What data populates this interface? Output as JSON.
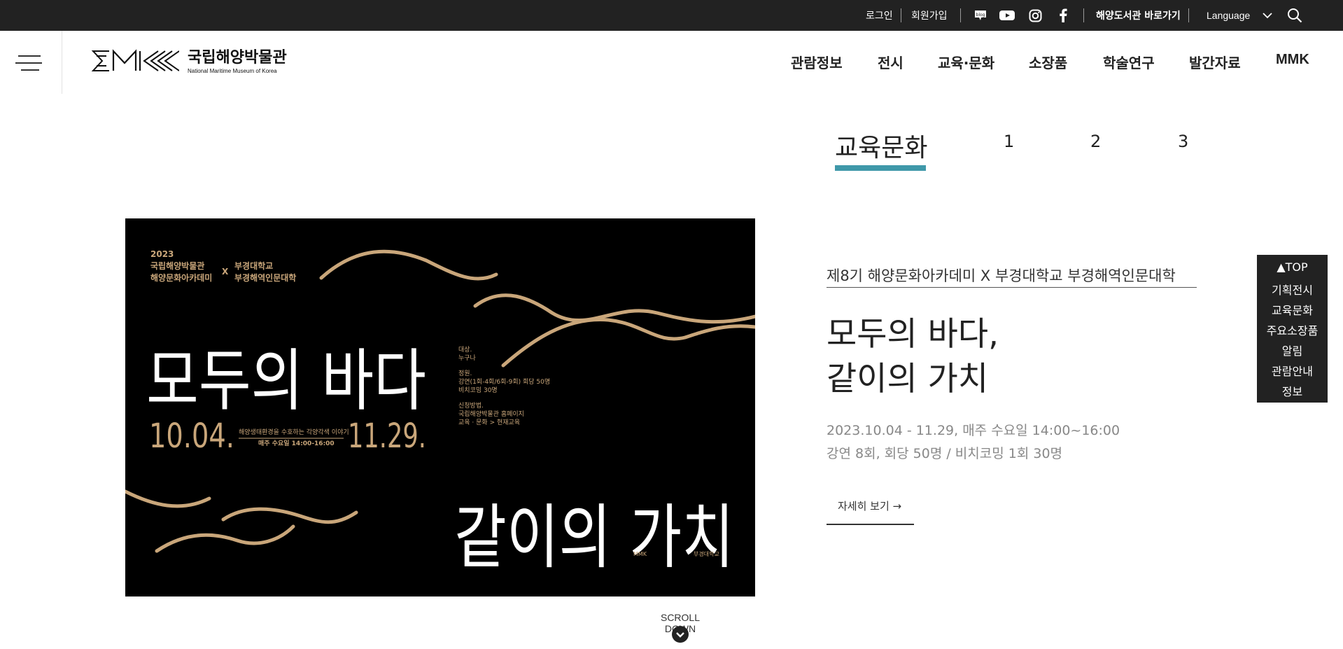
{
  "topbar": {
    "login": "로그인",
    "signup": "회원가입",
    "library_link": "해양도서관 바로가기",
    "language": "Language"
  },
  "header": {
    "logo_ko": "국립해양박물관",
    "logo_en": "National Maritime Museum of Korea",
    "nav": [
      "관람정보",
      "전시",
      "교육·문화",
      "소장품",
      "학술연구",
      "발간자료",
      "MMK"
    ]
  },
  "section_tabs": {
    "active": "교육문화",
    "pages": [
      "1",
      "2",
      "3"
    ]
  },
  "poster": {
    "year_org": "2023",
    "org_line1": "국립해양박물관",
    "org_line2": "해양문화아카데미",
    "x_mark": "X",
    "partner_line1": "부경대학교",
    "partner_line2": "부경해역인문대학",
    "headline_top": "모두의 바다",
    "headline_bottom": "같이의 가치",
    "date_start": "10.04.",
    "date_end": "11.29.",
    "tagline": "해양생태환경을 수호하는 각양각색 이야기",
    "schedule": "매주 수요일 14:00-16:00",
    "target_label": "대상.",
    "target_value": "누구나",
    "capacity_label": "정원.",
    "capacity_line1": "강연(1회-4회/6회-9회) 회당 50명",
    "capacity_line2": "비치코밍 30명",
    "apply_label": "신청방법.",
    "apply_line1": "국립해양박물관 홈페이지",
    "apply_line2": "교육 · 문화 > 현재교육",
    "footer_logo": "MMK",
    "footer_partner": "부경대학교"
  },
  "event": {
    "subtitle": "제8기 해양문화아카데미 X 부경대학교 부경해역인문대학",
    "title_line1": "모두의 바다,",
    "title_line2": "같이의 가치",
    "period": "2023.10.04 - 11.29, 매주 수요일 14:00~16:00",
    "detail": "강연 8회, 회당 50명 / 비치코밍 1회 30명",
    "more_label": "자세히 보기 →"
  },
  "quick_menu": [
    "▲TOP",
    "기획전시",
    "교육문화",
    "주요소장품",
    "알림",
    "관람안내",
    "정보"
  ],
  "scroll": {
    "label": "SCROLL DOWN"
  },
  "colors": {
    "accent": "#3f98a9",
    "gold": "#c9a67a",
    "dark": "#222222"
  }
}
